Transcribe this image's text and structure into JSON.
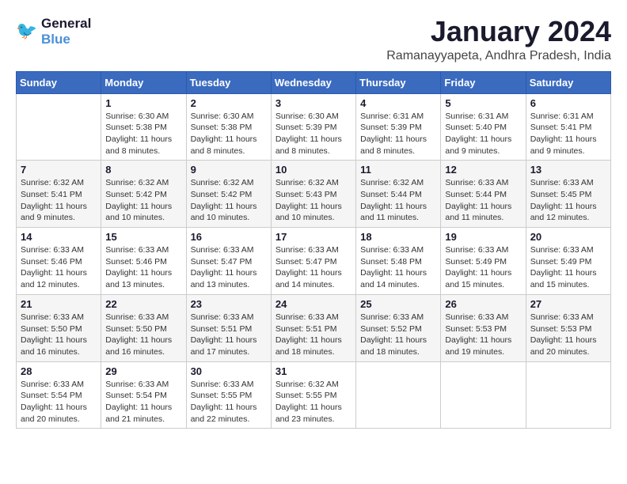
{
  "logo": {
    "line1": "General",
    "line2": "Blue"
  },
  "title": "January 2024",
  "subtitle": "Ramanayyapeta, Andhra Pradesh, India",
  "weekdays": [
    "Sunday",
    "Monday",
    "Tuesday",
    "Wednesday",
    "Thursday",
    "Friday",
    "Saturday"
  ],
  "weeks": [
    [
      {
        "day": "",
        "sunrise": "",
        "sunset": "",
        "daylight": ""
      },
      {
        "day": "1",
        "sunrise": "Sunrise: 6:30 AM",
        "sunset": "Sunset: 5:38 PM",
        "daylight": "Daylight: 11 hours and 8 minutes."
      },
      {
        "day": "2",
        "sunrise": "Sunrise: 6:30 AM",
        "sunset": "Sunset: 5:38 PM",
        "daylight": "Daylight: 11 hours and 8 minutes."
      },
      {
        "day": "3",
        "sunrise": "Sunrise: 6:30 AM",
        "sunset": "Sunset: 5:39 PM",
        "daylight": "Daylight: 11 hours and 8 minutes."
      },
      {
        "day": "4",
        "sunrise": "Sunrise: 6:31 AM",
        "sunset": "Sunset: 5:39 PM",
        "daylight": "Daylight: 11 hours and 8 minutes."
      },
      {
        "day": "5",
        "sunrise": "Sunrise: 6:31 AM",
        "sunset": "Sunset: 5:40 PM",
        "daylight": "Daylight: 11 hours and 9 minutes."
      },
      {
        "day": "6",
        "sunrise": "Sunrise: 6:31 AM",
        "sunset": "Sunset: 5:41 PM",
        "daylight": "Daylight: 11 hours and 9 minutes."
      }
    ],
    [
      {
        "day": "7",
        "sunrise": "Sunrise: 6:32 AM",
        "sunset": "Sunset: 5:41 PM",
        "daylight": "Daylight: 11 hours and 9 minutes."
      },
      {
        "day": "8",
        "sunrise": "Sunrise: 6:32 AM",
        "sunset": "Sunset: 5:42 PM",
        "daylight": "Daylight: 11 hours and 10 minutes."
      },
      {
        "day": "9",
        "sunrise": "Sunrise: 6:32 AM",
        "sunset": "Sunset: 5:42 PM",
        "daylight": "Daylight: 11 hours and 10 minutes."
      },
      {
        "day": "10",
        "sunrise": "Sunrise: 6:32 AM",
        "sunset": "Sunset: 5:43 PM",
        "daylight": "Daylight: 11 hours and 10 minutes."
      },
      {
        "day": "11",
        "sunrise": "Sunrise: 6:32 AM",
        "sunset": "Sunset: 5:44 PM",
        "daylight": "Daylight: 11 hours and 11 minutes."
      },
      {
        "day": "12",
        "sunrise": "Sunrise: 6:33 AM",
        "sunset": "Sunset: 5:44 PM",
        "daylight": "Daylight: 11 hours and 11 minutes."
      },
      {
        "day": "13",
        "sunrise": "Sunrise: 6:33 AM",
        "sunset": "Sunset: 5:45 PM",
        "daylight": "Daylight: 11 hours and 12 minutes."
      }
    ],
    [
      {
        "day": "14",
        "sunrise": "Sunrise: 6:33 AM",
        "sunset": "Sunset: 5:46 PM",
        "daylight": "Daylight: 11 hours and 12 minutes."
      },
      {
        "day": "15",
        "sunrise": "Sunrise: 6:33 AM",
        "sunset": "Sunset: 5:46 PM",
        "daylight": "Daylight: 11 hours and 13 minutes."
      },
      {
        "day": "16",
        "sunrise": "Sunrise: 6:33 AM",
        "sunset": "Sunset: 5:47 PM",
        "daylight": "Daylight: 11 hours and 13 minutes."
      },
      {
        "day": "17",
        "sunrise": "Sunrise: 6:33 AM",
        "sunset": "Sunset: 5:47 PM",
        "daylight": "Daylight: 11 hours and 14 minutes."
      },
      {
        "day": "18",
        "sunrise": "Sunrise: 6:33 AM",
        "sunset": "Sunset: 5:48 PM",
        "daylight": "Daylight: 11 hours and 14 minutes."
      },
      {
        "day": "19",
        "sunrise": "Sunrise: 6:33 AM",
        "sunset": "Sunset: 5:49 PM",
        "daylight": "Daylight: 11 hours and 15 minutes."
      },
      {
        "day": "20",
        "sunrise": "Sunrise: 6:33 AM",
        "sunset": "Sunset: 5:49 PM",
        "daylight": "Daylight: 11 hours and 15 minutes."
      }
    ],
    [
      {
        "day": "21",
        "sunrise": "Sunrise: 6:33 AM",
        "sunset": "Sunset: 5:50 PM",
        "daylight": "Daylight: 11 hours and 16 minutes."
      },
      {
        "day": "22",
        "sunrise": "Sunrise: 6:33 AM",
        "sunset": "Sunset: 5:50 PM",
        "daylight": "Daylight: 11 hours and 16 minutes."
      },
      {
        "day": "23",
        "sunrise": "Sunrise: 6:33 AM",
        "sunset": "Sunset: 5:51 PM",
        "daylight": "Daylight: 11 hours and 17 minutes."
      },
      {
        "day": "24",
        "sunrise": "Sunrise: 6:33 AM",
        "sunset": "Sunset: 5:51 PM",
        "daylight": "Daylight: 11 hours and 18 minutes."
      },
      {
        "day": "25",
        "sunrise": "Sunrise: 6:33 AM",
        "sunset": "Sunset: 5:52 PM",
        "daylight": "Daylight: 11 hours and 18 minutes."
      },
      {
        "day": "26",
        "sunrise": "Sunrise: 6:33 AM",
        "sunset": "Sunset: 5:53 PM",
        "daylight": "Daylight: 11 hours and 19 minutes."
      },
      {
        "day": "27",
        "sunrise": "Sunrise: 6:33 AM",
        "sunset": "Sunset: 5:53 PM",
        "daylight": "Daylight: 11 hours and 20 minutes."
      }
    ],
    [
      {
        "day": "28",
        "sunrise": "Sunrise: 6:33 AM",
        "sunset": "Sunset: 5:54 PM",
        "daylight": "Daylight: 11 hours and 20 minutes."
      },
      {
        "day": "29",
        "sunrise": "Sunrise: 6:33 AM",
        "sunset": "Sunset: 5:54 PM",
        "daylight": "Daylight: 11 hours and 21 minutes."
      },
      {
        "day": "30",
        "sunrise": "Sunrise: 6:33 AM",
        "sunset": "Sunset: 5:55 PM",
        "daylight": "Daylight: 11 hours and 22 minutes."
      },
      {
        "day": "31",
        "sunrise": "Sunrise: 6:32 AM",
        "sunset": "Sunset: 5:55 PM",
        "daylight": "Daylight: 11 hours and 23 minutes."
      },
      {
        "day": "",
        "sunrise": "",
        "sunset": "",
        "daylight": ""
      },
      {
        "day": "",
        "sunrise": "",
        "sunset": "",
        "daylight": ""
      },
      {
        "day": "",
        "sunrise": "",
        "sunset": "",
        "daylight": ""
      }
    ]
  ]
}
